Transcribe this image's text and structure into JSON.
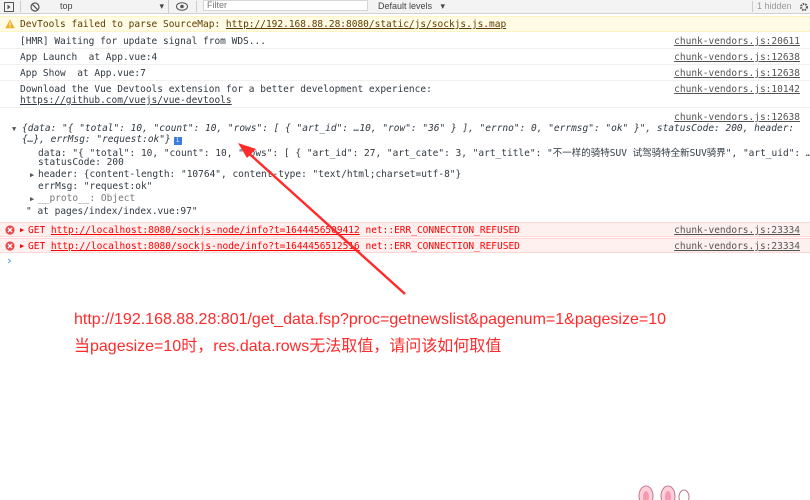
{
  "toolbar": {
    "context": "top",
    "filter_placeholder": "Filter",
    "levels": "Default levels",
    "hidden": "1 hidden"
  },
  "messages": {
    "warning": {
      "text_prefix": "DevTools failed to parse SourceMap: ",
      "url": "http://192.168.88.28:8080/static/js/sockjs.js.map"
    },
    "hmr": {
      "text": "[HMR] Waiting for update signal from WDS...",
      "source": "chunk-vendors.js:20611"
    },
    "launch": {
      "text": "App Launch  at App.vue:4",
      "source": "chunk-vendors.js:12638"
    },
    "show": {
      "text": "App Show  at App.vue:7",
      "source": "chunk-vendors.js:12638"
    },
    "devtools": {
      "text": "Download the Vue Devtools extension for a better development experience:",
      "url": "https://github.com/vuejs/vue-devtools",
      "source": "chunk-vendors.js:10142"
    },
    "object_source": "chunk-vendors.js:12638",
    "object_summary_1": "{data: \"{ \"total\": 10, \"count\": 10, \"rows\": [ { \"art_id\": …10, \"row\": \"36\" } ], \"errno\": 0, \"errmsg\": \"ok\" }\", statusCode: 200, header:",
    "object_summary_2": "{…}, errMsg: \"request:ok\"}",
    "data_line": "data: \"{ \"total\": 10, \"count\": 10, \"rows\": [ { \"art_id\": 27, \"art_cate\": 3, \"art_title\": \"不一样的骑特SUV 试驾骑特全新SUV骑界\", \"art_uid\": …",
    "status_line": "statusCode: 200",
    "header_line": "header: {content-length: \"10764\", content-type: \"text/html;charset=utf-8\"}",
    "errmsg_line": "errMsg: \"request:ok\"",
    "proto_line": "__proto__: Object",
    "at_line": "\" at pages/index/index.vue:97\"",
    "error1": {
      "prefix": "GET ",
      "url": "http://localhost:8080/sockjs-node/info?t=1644456509412",
      "suffix": " net::ERR_CONNECTION_REFUSED",
      "source": "chunk-vendors.js:23334"
    },
    "error2": {
      "prefix": "GET ",
      "url": "http://localhost:8080/sockjs-node/info?t=1644456512516",
      "suffix": " net::ERR_CONNECTION_REFUSED",
      "source": "chunk-vendors.js:23334"
    },
    "prompt": "›"
  },
  "annotation": {
    "line1": "http://192.168.88.28:801/get_data.fsp?proc=getnewslist&pagenum=1&pagesize=10",
    "line2": "当pagesize=10时，res.data.rows无法取值，请问该如何取值"
  },
  "colors": {
    "annotation": "#ff2a2a",
    "error": "#ff0000",
    "warning_bg": "#fffbe5",
    "error_bg": "#fff0f0"
  }
}
